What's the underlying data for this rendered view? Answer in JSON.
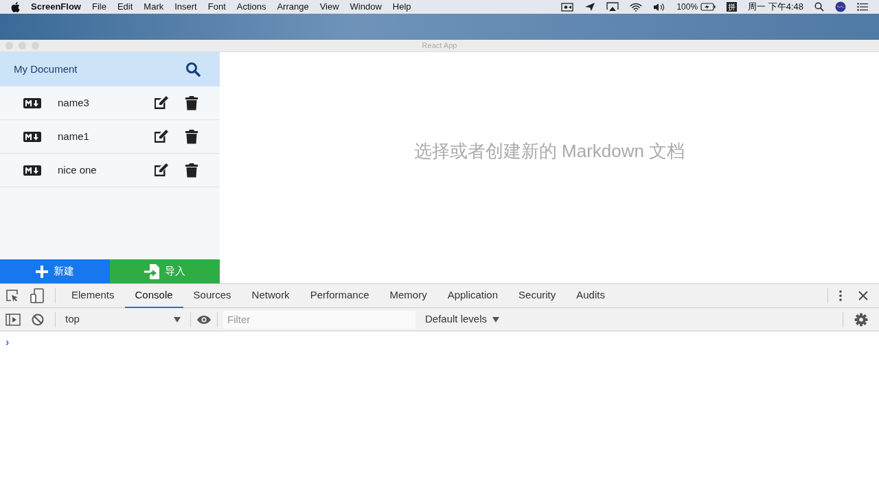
{
  "menu_bar": {
    "app_name": "ScreenFlow",
    "menus": [
      "File",
      "Edit",
      "Mark",
      "Insert",
      "Font",
      "Actions",
      "Arrange",
      "View",
      "Window",
      "Help"
    ],
    "battery": "100%",
    "input_method": "拼",
    "clock": "周一 下午4:48"
  },
  "window": {
    "title": "React App"
  },
  "sidebar": {
    "title": "My Document",
    "files": [
      {
        "name": "name3"
      },
      {
        "name": "name1"
      },
      {
        "name": "nice one"
      }
    ],
    "buttons": [
      {
        "label": "新建",
        "kind": "new"
      },
      {
        "label": "导入",
        "kind": "import"
      }
    ]
  },
  "main": {
    "empty_message": "选择或者创建新的 Markdown 文档"
  },
  "devtools": {
    "tabs": [
      {
        "label": "Elements",
        "selected": false
      },
      {
        "label": "Console",
        "selected": true
      },
      {
        "label": "Sources",
        "selected": false
      },
      {
        "label": "Network",
        "selected": false
      },
      {
        "label": "Performance",
        "selected": false
      },
      {
        "label": "Memory",
        "selected": false
      },
      {
        "label": "Application",
        "selected": false
      },
      {
        "label": "Security",
        "selected": false
      },
      {
        "label": "Audits",
        "selected": false
      }
    ],
    "context": "top",
    "filter": {
      "placeholder": "Filter"
    },
    "levels": "Default levels",
    "prompt": "›"
  }
}
